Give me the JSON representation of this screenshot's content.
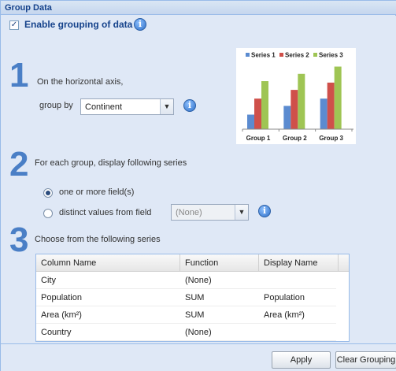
{
  "title": "Group Data",
  "enable": {
    "label": "Enable grouping of data",
    "checked": true
  },
  "step1": {
    "number": "1",
    "text": "On the horizontal axis,",
    "group_by_label": "group by",
    "group_by_value": "Continent"
  },
  "step2": {
    "number": "2",
    "text": "For each group, display following series",
    "option1": "one or more field(s)",
    "option2": "distinct values from field",
    "field_value": "(None)"
  },
  "step3": {
    "number": "3",
    "text": "Choose from the following series"
  },
  "grid": {
    "columns": [
      "Column Name",
      "Function",
      "Display Name"
    ],
    "rows": [
      [
        "City",
        "(None)",
        ""
      ],
      [
        "Population",
        "SUM",
        "Population"
      ],
      [
        "Area (km²)",
        "SUM",
        "Area (km²)"
      ],
      [
        "Country",
        "(None)",
        ""
      ]
    ]
  },
  "buttons": {
    "apply": "Apply",
    "clear": "Clear Grouping"
  },
  "chart_data": {
    "type": "bar",
    "categories": [
      "Group 1",
      "Group 2",
      "Group 3"
    ],
    "series": [
      {
        "name": "Series 1",
        "color": "#5b8bd0",
        "values": [
          1.0,
          1.6,
          2.1
        ]
      },
      {
        "name": "Series 2",
        "color": "#cf504a",
        "values": [
          2.1,
          2.7,
          3.2
        ]
      },
      {
        "name": "Series 3",
        "color": "#9fc554",
        "values": [
          3.3,
          3.8,
          4.3
        ]
      }
    ],
    "ylim": [
      0,
      4.6
    ]
  }
}
